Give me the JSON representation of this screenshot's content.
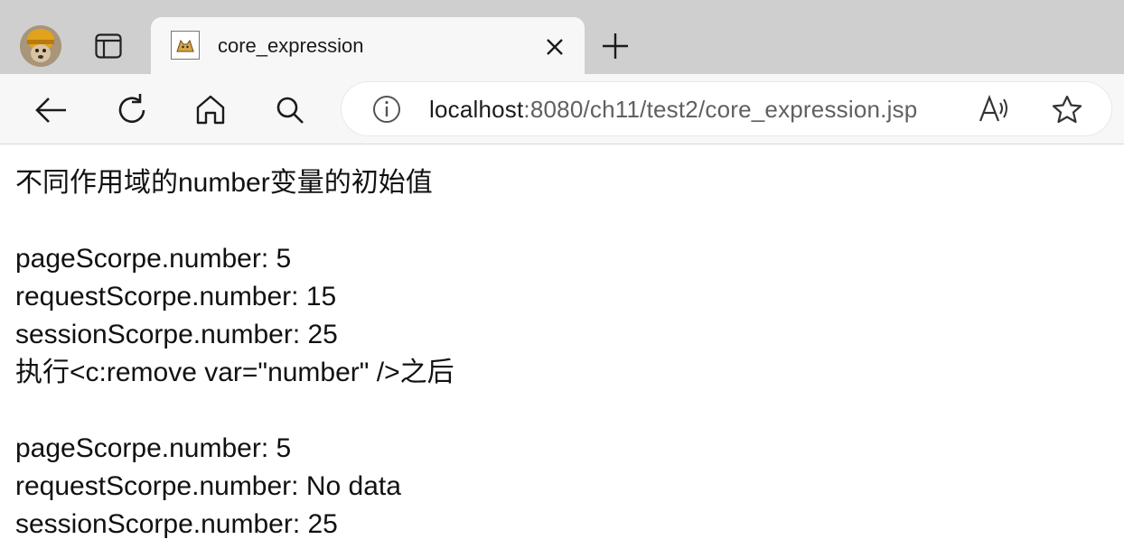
{
  "browser": {
    "tab": {
      "title": "core_expression"
    },
    "address": {
      "host": "localhost",
      "rest": ":8080/ch11/test2/core_expression.jsp"
    }
  },
  "page": {
    "heading": "不同作用域的number变量的初始值",
    "initial": [
      "pageScorpe.number: 5",
      "requestScorpe.number: 15",
      "sessionScorpe.number: 25"
    ],
    "after_heading": "执行<c:remove var=\"number\" />之后",
    "after": [
      "pageScorpe.number: 5",
      "requestScorpe.number: No data",
      "sessionScorpe.number: 25"
    ]
  },
  "icons": {
    "profile": "avatar",
    "tab_actions": "tab-actions-icon",
    "favicon": "tomcat-icon",
    "close": "close-icon",
    "new_tab": "plus-icon",
    "back": "back-arrow-icon",
    "refresh": "refresh-icon",
    "home": "home-icon",
    "search": "search-icon",
    "site_info": "info-icon",
    "read_aloud": "read-aloud-icon",
    "favorite": "star-icon"
  }
}
